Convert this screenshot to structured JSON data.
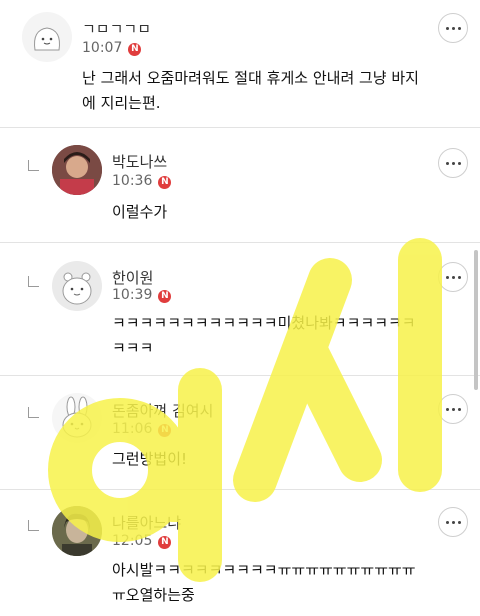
{
  "comments": [
    {
      "name": "ㄱㅁㄱㄱㅁ",
      "time": "10:07",
      "badge": "N",
      "lines": [
        "난 그래서 오줌마려워도 절대 휴게소 안내려 그냥 바지",
        "에 지리는편."
      ],
      "reply": false,
      "avatar_icon": "blob-face-avatar"
    },
    {
      "name": "박도나쓰",
      "time": "10:36",
      "badge": "N",
      "lines": [
        "이럴수가"
      ],
      "reply": true,
      "avatar_icon": "photo-avatar"
    },
    {
      "name": "한이원",
      "time": "10:39",
      "badge": "N",
      "lines": [
        "ㅋㅋㅋㅋㅋㅋㅋㅋㅋㅋㅋㅋ미쳤나봐ㅋㅋㅋㅋㅋㅋ",
        "ㅋㅋㅋ"
      ],
      "reply": true,
      "avatar_icon": "hamster-avatar"
    },
    {
      "name": "돈좀아껴 김여시",
      "time": "11:06",
      "badge": "N",
      "lines": [
        "그런방법이!"
      ],
      "reply": true,
      "avatar_icon": "rabbit-avatar"
    },
    {
      "name": "나를아느냐",
      "time": "12:05",
      "badge": "N",
      "lines": [
        "아시발ㅋㅋㅋㅋㅋㅋㅋㅋㅋㅠㅠㅠㅠㅠㅠㅠㅠㅠㅠ",
        "ㅠ오열하는중"
      ],
      "reply": true,
      "avatar_icon": "photo-avatar"
    }
  ],
  "watermark": {
    "text": "여시",
    "color": "#f7f24a"
  }
}
